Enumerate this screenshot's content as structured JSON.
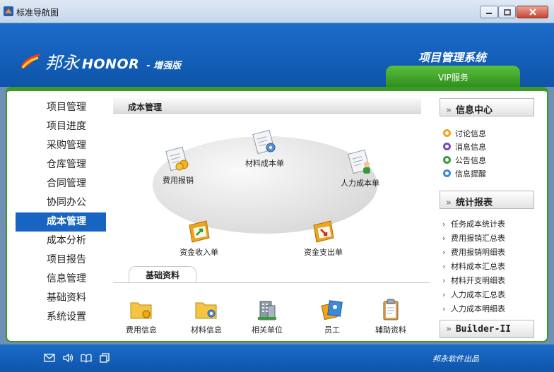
{
  "window": {
    "title": "标准导航图"
  },
  "header": {
    "brand_cn": "邦永",
    "brand_en": "HONOR",
    "edition": "- 增强版",
    "system_title": "项目管理系统",
    "vip_tab": "VIP服务"
  },
  "nav": {
    "items": [
      "项目管理",
      "项目进度",
      "采购管理",
      "仓库管理",
      "合同管理",
      "协同办公",
      "成本管理",
      "成本分析",
      "项目报告",
      "信息管理",
      "基础资料",
      "系统设置"
    ],
    "active": "成本管理"
  },
  "content": {
    "title": "成本管理",
    "flow": {
      "expense": "费用报销",
      "material_cost": "材料成本单",
      "labor_cost": "人力成本单",
      "income": "资金收入单",
      "payment": "资金支出单"
    },
    "basic_tab": "基础资料",
    "basic": {
      "expense_info": "费用信息",
      "material_info": "材料信息",
      "units": "相关单位",
      "staff": "员工",
      "aux": "辅助资料"
    }
  },
  "right": {
    "info_center": "信息中心",
    "info_items": [
      "讨论信息",
      "消息信息",
      "公告信息",
      "信息提醒"
    ],
    "reports": "统计报表",
    "report_items": [
      "任务成本统计表",
      "费用报销汇总表",
      "费用报销明细表",
      "材料成本汇总表",
      "材料开支明细表",
      "人力成本汇总表",
      "人力成本明细表"
    ],
    "builder": "Builder-II",
    "arrow": "»"
  },
  "footer": {
    "credit": "邦永软件出品"
  },
  "colors": {
    "header_blue": "#1764c2",
    "accent_green": "#3b9a23",
    "active_nav": "#1764c2"
  }
}
